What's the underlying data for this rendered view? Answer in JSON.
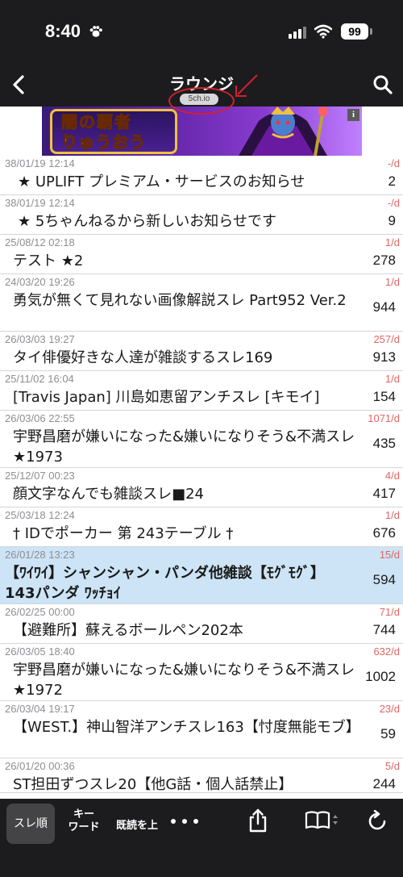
{
  "status_bar": {
    "time": "8:40",
    "battery": "99"
  },
  "nav": {
    "title": "ラウンジ",
    "subtitle": "5ch.io"
  },
  "ad": {
    "line1": "闇の覇者",
    "line2": "りゅうおう",
    "info": "i"
  },
  "threads": [
    {
      "date": "38/01/19 12:14",
      "rate": "-/d",
      "title": "★ UPLIFT プレミアム・サービスのお知らせ",
      "count": "2",
      "selected": false
    },
    {
      "date": "38/01/19 12:14",
      "rate": "-/d",
      "title": "★ 5ちゃんねるから新しいお知らせです",
      "count": "9",
      "selected": false
    },
    {
      "date": "25/08/12 02:18",
      "rate": "1/d",
      "title": "テスト ★2",
      "count": "278",
      "selected": false
    },
    {
      "date": "24/03/20 19:26",
      "rate": "1/d",
      "title": "勇気が無くて見れない画像解説スレ Part952 Ver.2",
      "count": "944",
      "selected": false
    },
    {
      "date": "26/03/03 19:27",
      "rate": "257/d",
      "title": "タイ俳優好きな人達が雑談するスレ169",
      "count": "913",
      "selected": false
    },
    {
      "date": "25/11/02 16:04",
      "rate": "1/d",
      "title": "[Travis Japan] 川島如恵留アンチスレ [キモイ]",
      "count": "154",
      "selected": false
    },
    {
      "date": "26/03/06 22:55",
      "rate": "1071/d",
      "title": "宇野昌磨が嫌いになった&嫌いになりそう&不満スレ★1973",
      "count": "435",
      "selected": false
    },
    {
      "date": "25/12/07 00:23",
      "rate": "4/d",
      "title": "顔文字なんでも雑談スレ■24",
      "count": "417",
      "selected": false
    },
    {
      "date": "25/03/18 12:24",
      "rate": "1/d",
      "title": "† IDでポーカー 第 243テーブル †",
      "count": "676",
      "selected": false
    },
    {
      "date": "26/01/28 13:23",
      "rate": "15/d",
      "title": "【ﾜｲﾜｲ】シャンシャン・パンダ他雑談【ﾓｸﾞﾓｸﾞ】143パンダ ﾜｯﾁｮｲ",
      "count": "594",
      "selected": true
    },
    {
      "date": "26/02/25 00:00",
      "rate": "71/d",
      "title": "【避難所】蘇えるボールペン202本",
      "count": "744",
      "selected": false
    },
    {
      "date": "26/03/05 18:40",
      "rate": "632/d",
      "title": "宇野昌磨が嫌いになった&嫌いになりそう&不満スレ★1972",
      "count": "1002",
      "selected": false
    },
    {
      "date": "26/03/04 19:17",
      "rate": "23/d",
      "title": "【WEST.】神山智洋アンチスレ163【忖度無能モブ】",
      "count": "59",
      "selected": false
    },
    {
      "date": "26/01/20 00:36",
      "rate": "5/d",
      "title": "ST担田ずつスレ20【他G話・個人話禁止】",
      "count": "244",
      "selected": false
    }
  ],
  "toolbar": {
    "sure_order": "スレ順",
    "keyword_l1": "キー",
    "keyword_l2": "ワード",
    "kidoku": "既読を上"
  },
  "colors": {
    "bar": "#1c1c1e",
    "rate": "#e06666",
    "selected_row": "#cce4f5",
    "annotation": "#d32030"
  }
}
